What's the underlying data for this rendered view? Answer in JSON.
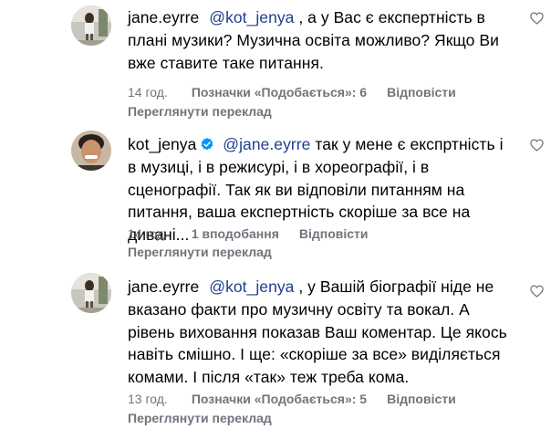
{
  "comments": [
    {
      "username": "jane.eyrre",
      "mention": "@kot_jenya",
      "text": " , а у Вас є експертність в плані музики? Музична освіта можливо? Якщо Ви вже ставите таке питання.",
      "time": "14 год.",
      "likes": "Позначки «Подобається»: 6",
      "reply": "Відповісти",
      "translate": "Переглянути переклад",
      "verified": false,
      "avatar": "avatar-jane",
      "like_icon": "heart-icon"
    },
    {
      "username": "kot_jenya",
      "mention": "@jane.eyrre",
      "text": " так у мене є експртність і в музиці, і в режисурі, і в хореографії, і в сценографії. Так як ви відповіли питанням на питання, ваша експертність скоріше за все на дивані...",
      "time": "14 год.",
      "likes": "1 вподобання",
      "reply": "Відповісти",
      "translate": "Переглянути переклад",
      "verified": true,
      "avatar": "avatar-kot",
      "like_icon": "heart-icon"
    },
    {
      "username": "jane.eyrre",
      "mention": "@kot_jenya",
      "text": " , у Вашій біографії ніде не вказано факти про музичну освіту та вокал. А рівень виховання показав Ваш коментар. Це якось навіть смішно. І ще: «скоріше за все» виділяється комами. І після «так» теж треба кома.",
      "time": "13 год.",
      "likes": "Позначки «Подобається»: 5",
      "reply": "Відповісти",
      "translate": "Переглянути переклад",
      "verified": false,
      "avatar": "avatar-jane",
      "like_icon": "heart-icon"
    }
  ],
  "colors": {
    "mention": "#1e3f8c",
    "meta": "#73737d",
    "verified": "#0095f6"
  }
}
